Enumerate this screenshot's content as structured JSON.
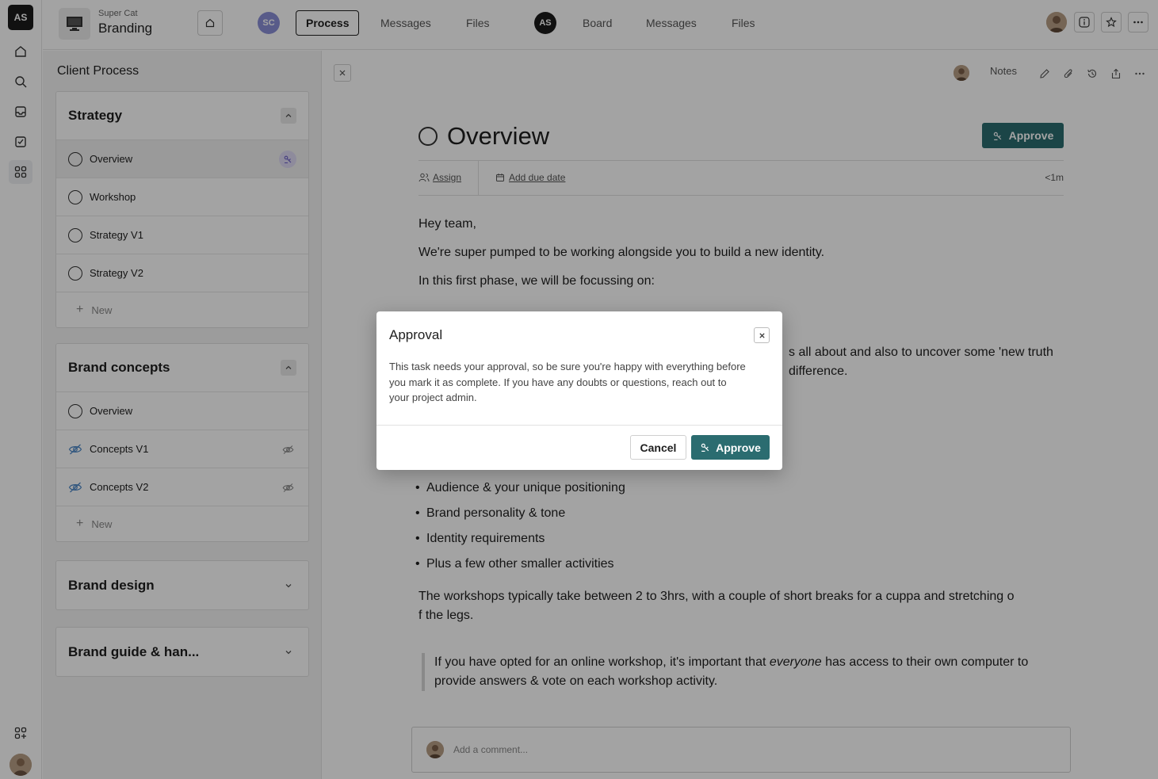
{
  "rail": {
    "logo": "AS",
    "items": [
      "home",
      "search",
      "inbox",
      "tasks",
      "apps"
    ]
  },
  "topbar": {
    "workspace": "Super Cat",
    "project": "Branding",
    "client_badge": "SC",
    "client_tabs": [
      "Process",
      "Messages",
      "Files"
    ],
    "team_badge": "AS",
    "team_tabs": [
      "Board",
      "Messages",
      "Files"
    ]
  },
  "panel": {
    "title": "Client Process",
    "sections": [
      {
        "title": "Strategy",
        "expanded": true,
        "items": [
          "Overview",
          "Workshop",
          "Strategy V1",
          "Strategy V2"
        ],
        "new_label": "New"
      },
      {
        "title": "Brand concepts",
        "expanded": true,
        "items": [
          "Overview",
          "Concepts V1",
          "Concepts V2"
        ],
        "new_label": "New"
      },
      {
        "title": "Brand design",
        "expanded": false
      },
      {
        "title": "Brand guide & han...",
        "expanded": false
      }
    ]
  },
  "doc": {
    "notes_label": "Notes",
    "title": "Overview",
    "approve_label": "Approve",
    "assign_label": "Assign",
    "due_label": "Add due date",
    "time": "<1m",
    "greeting": "Hey team,",
    "p1": "We're super pumped to be working alongside you to build a new identity.",
    "p2": "In this first phase, we will be focussing on:",
    "partial_line1": "s all about and also to uncover some 'new truth",
    "partial_line2": "difference.",
    "bullets": [
      "Audience & your unique positioning",
      "Brand personality & tone",
      "Identity requirements",
      "Plus a few other smaller activities"
    ],
    "p3_line1": "The workshops typically take between 2 to 3hrs, with a couple of short breaks for a cuppa and stretching o",
    "p3_line2": "f the legs.",
    "quote_before": "If you have opted for an online workshop, it's important that ",
    "quote_em": "everyone",
    "quote_after": " has access to their own computer to provide answers & vote on each workshop activity.",
    "comment_placeholder": "Add a comment..."
  },
  "modal": {
    "title": "Approval",
    "body": "This task needs your approval, so be sure you're happy with everything before you mark it as complete. If you have any doubts or questions, reach out to your project admin.",
    "cancel": "Cancel",
    "approve": "Approve"
  },
  "colors": {
    "accent": "#2b6c70",
    "client_badge": "#8a8fd6",
    "team_badge": "#1c1c1c",
    "approval_icon_bg": "#ded9f5"
  }
}
